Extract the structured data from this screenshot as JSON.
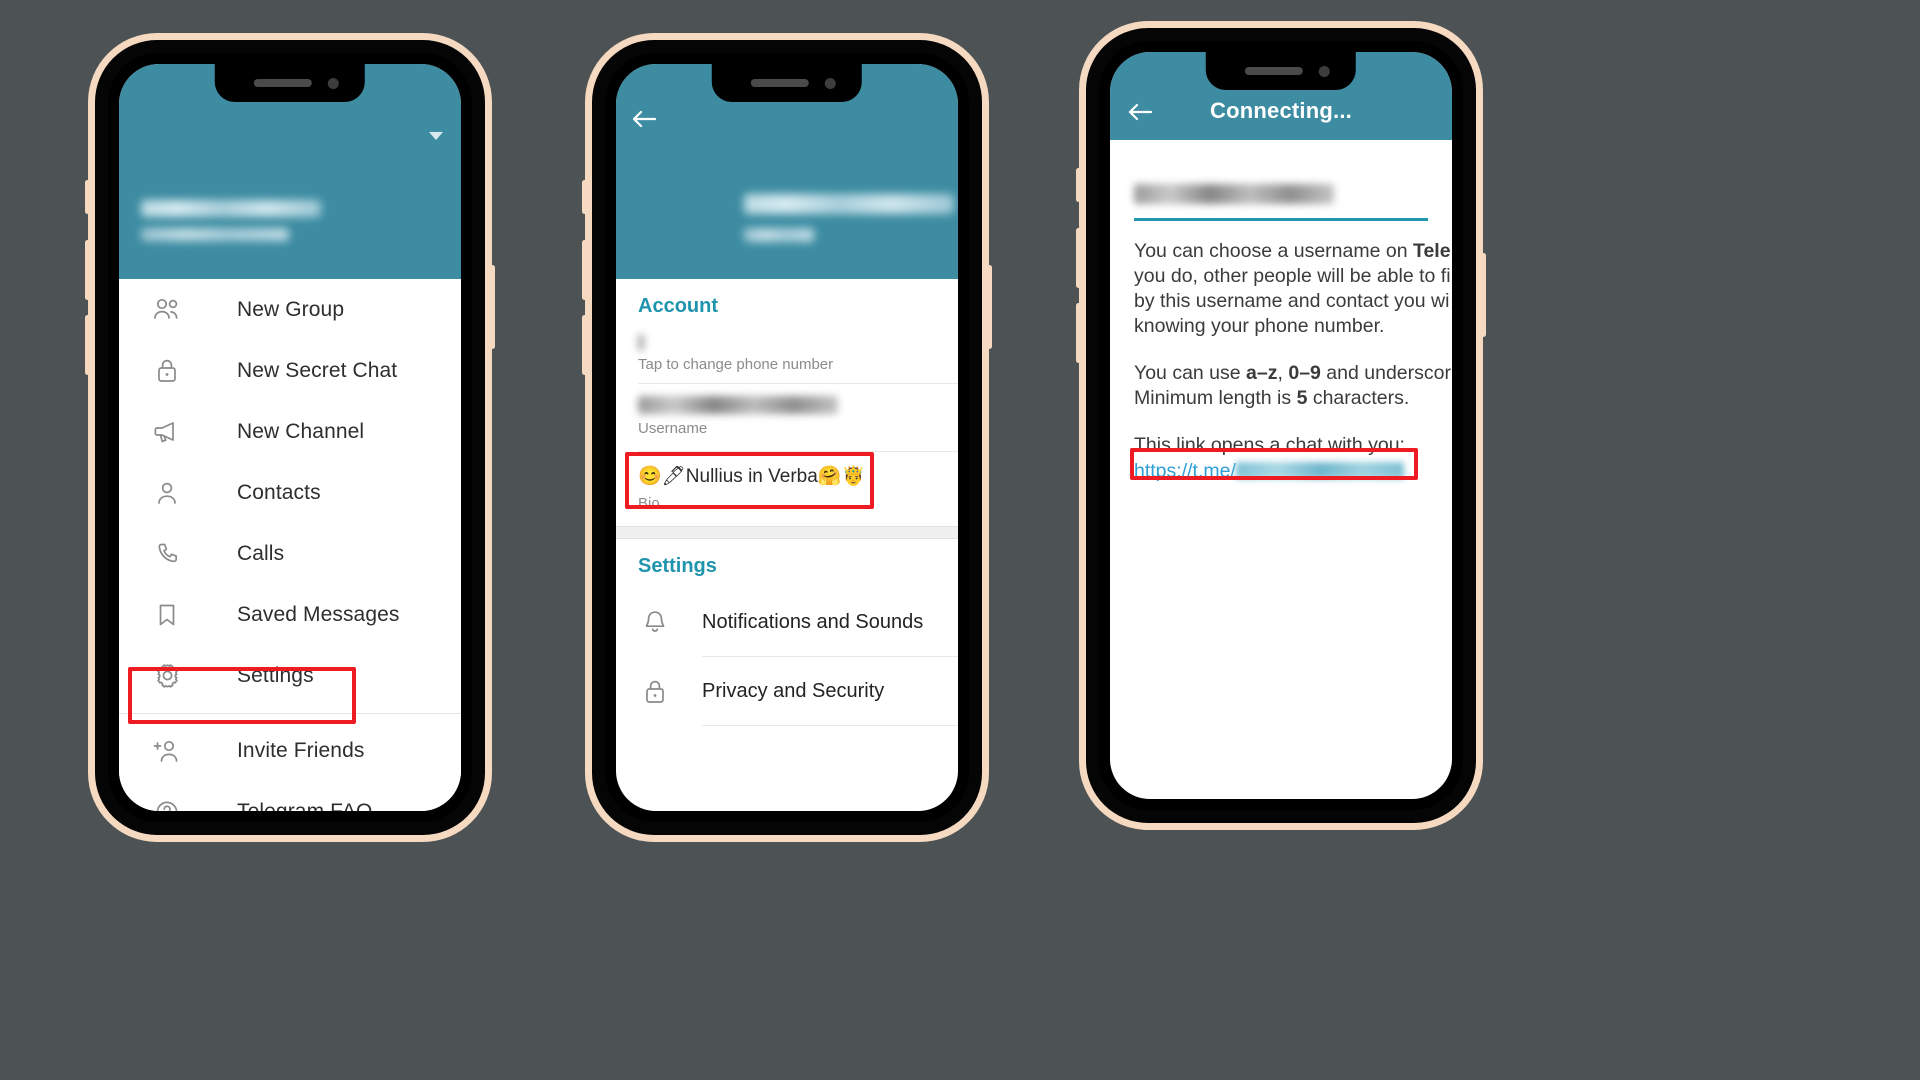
{
  "meta": {
    "app": "Telegram",
    "background_color": "#4d5355",
    "accent_teal": "#3d8ca2",
    "accent_link": "#1e94ad",
    "highlight_red": "#ef1b23"
  },
  "phone1": {
    "header": {
      "profile_name_redacted": true,
      "profile_phone_redacted": true
    },
    "menu": [
      {
        "label": "New Group",
        "icon": "two-people-icon"
      },
      {
        "label": "New Secret Chat",
        "icon": "lock-icon"
      },
      {
        "label": "New Channel",
        "icon": "megaphone-icon"
      },
      {
        "label": "Contacts",
        "icon": "person-icon"
      },
      {
        "label": "Calls",
        "icon": "phone-icon"
      },
      {
        "label": "Saved Messages",
        "icon": "bookmark-icon"
      },
      {
        "label": "Settings",
        "icon": "gear-icon",
        "highlighted": true
      },
      {
        "label": "Invite Friends",
        "icon": "add-person-icon"
      },
      {
        "label": "Telegram FAQ",
        "icon": "question-circle-icon"
      }
    ]
  },
  "phone2": {
    "back_label": "back-arrow",
    "header": {
      "profile_name_redacted": true,
      "profile_status": "online"
    },
    "account": {
      "section_title": "Account",
      "phone_row": {
        "value_redacted": true,
        "caption": "Tap to change phone number"
      },
      "username_row": {
        "value_redacted": true,
        "caption": "Username",
        "highlighted": true
      },
      "bio_row": {
        "value": "😊🖊Nullius in Verba🤗🤴",
        "caption": "Bio"
      }
    },
    "settings": {
      "section_title": "Settings",
      "items": [
        {
          "label": "Notifications and Sounds",
          "icon": "bell-icon"
        },
        {
          "label": "Privacy and Security",
          "icon": "lock-icon"
        }
      ]
    }
  },
  "phone3": {
    "back_label": "back-arrow",
    "title": "Connecting...",
    "username_field": {
      "value_redacted": true
    },
    "paragraphs": [
      {
        "lines": [
          [
            {
              "t": "You can choose a username on "
            },
            {
              "t": "Tele",
              "bold": true
            }
          ],
          [
            {
              "t": "you do, other people will be able to fi"
            }
          ],
          [
            {
              "t": "by this username and contact you wi"
            }
          ],
          [
            {
              "t": "knowing your phone number."
            }
          ]
        ]
      },
      {
        "lines": [
          [
            {
              "t": "You can use "
            },
            {
              "t": "a–z",
              "bold": true
            },
            {
              "t": ", "
            },
            {
              "t": "0–9",
              "bold": true
            },
            {
              "t": " and underscor"
            }
          ],
          [
            {
              "t": "Minimum length is "
            },
            {
              "t": "5",
              "bold": true
            },
            {
              "t": " characters."
            }
          ]
        ]
      },
      {
        "lines": [
          [
            {
              "t": "This link opens a chat with you:"
            }
          ]
        ]
      }
    ],
    "link": {
      "prefix": "https://t.me/",
      "suffix_redacted": true,
      "highlighted": true
    }
  }
}
